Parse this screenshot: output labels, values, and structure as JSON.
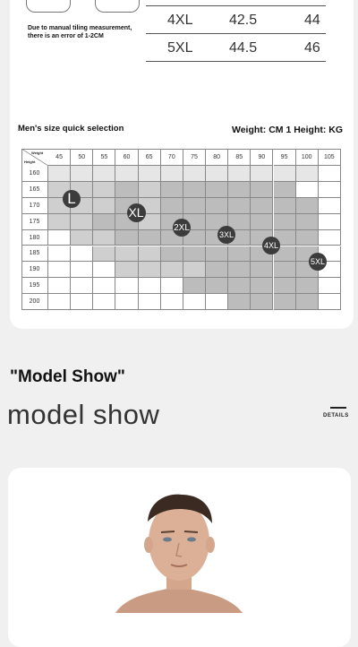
{
  "note_lines": [
    "Due to manual tiling measurement,",
    "there is an error of 1-2CM"
  ],
  "size_table": [
    {
      "size": "4XL",
      "a": "42.5",
      "b": "44"
    },
    {
      "size": "5XL",
      "a": "44.5",
      "b": "46"
    }
  ],
  "quick_title": "Men's size quick selection",
  "weight_height": "Weight: CM 1 Height: KG",
  "grid": {
    "weight_label": "Weight",
    "height_label": "Height",
    "weights": [
      "45",
      "50",
      "55",
      "60",
      "65",
      "70",
      "75",
      "80",
      "85",
      "90",
      "95",
      "100",
      "105"
    ],
    "heights": [
      "160",
      "165",
      "170",
      "175",
      "180",
      "185",
      "190",
      "195",
      "200"
    ],
    "shade": [
      "GGGGGGGGGGGG",
      "LLLDLDDDDDDW",
      "LLLDLDDDDDDD",
      "LLDDLDDDDDDD",
      "WLLDDDDDDDDD",
      "WWLLLDDDDDDD",
      "WWWLLLLDDDDD",
      "WWWWWWDDDDDD",
      "WWWWWWWWDDDD"
    ],
    "colors": {
      "G": "#e6e6e6",
      "L": "#cfcfcf",
      "D": "#bcbcbc",
      "W": "#ffffff"
    },
    "badges": [
      "L",
      "XL",
      "2XL",
      "3XL",
      "4XL",
      "5XL"
    ]
  },
  "model_show_title": "\"Model Show\"",
  "model_show_subtitle": "model show",
  "details_label": "DETAILS"
}
